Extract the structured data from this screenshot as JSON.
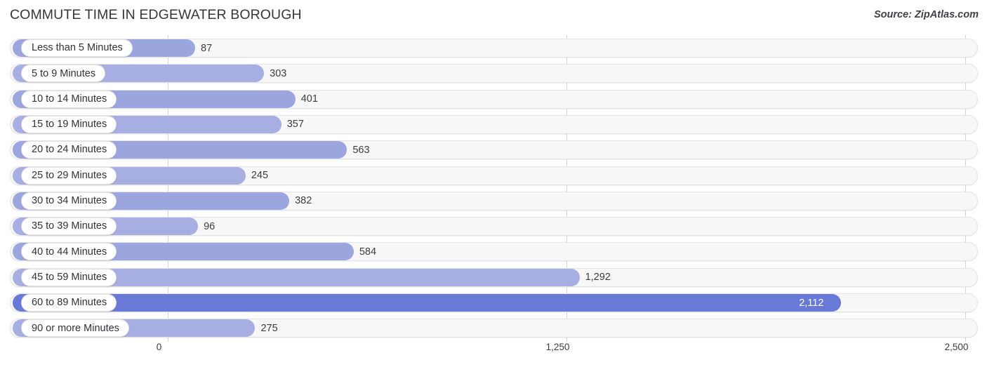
{
  "header": {
    "title": "COMMUTE TIME IN EDGEWATER BOROUGH",
    "source": "Source: ZipAtlas.com"
  },
  "colors": {
    "bar": "#9ba5de",
    "bar_alt": "#a7afe2",
    "bar_highlight": "#6979d8",
    "track": "#f7f7f7",
    "gridline": "#d5d6d8",
    "text": "#3a3d42"
  },
  "chart_data": {
    "type": "bar",
    "orientation": "horizontal",
    "title": "COMMUTE TIME IN EDGEWATER BOROUGH",
    "xlabel": "",
    "ylabel": "",
    "xlim": [
      0,
      2500
    ],
    "grid": true,
    "legend": null,
    "xticks": [
      "0",
      "1,250",
      "2,500"
    ],
    "xtick_values": [
      0,
      1250,
      2500
    ],
    "categories": [
      "Less than 5 Minutes",
      "5 to 9 Minutes",
      "10 to 14 Minutes",
      "15 to 19 Minutes",
      "20 to 24 Minutes",
      "25 to 29 Minutes",
      "30 to 34 Minutes",
      "35 to 39 Minutes",
      "40 to 44 Minutes",
      "45 to 59 Minutes",
      "60 to 89 Minutes",
      "90 or more Minutes"
    ],
    "values": [
      87,
      303,
      401,
      357,
      563,
      245,
      382,
      96,
      584,
      1292,
      2112,
      275
    ],
    "value_labels": [
      "87",
      "303",
      "401",
      "357",
      "563",
      "245",
      "382",
      "96",
      "584",
      "1,292",
      "2,112",
      "275"
    ],
    "highlight_index": 10
  }
}
